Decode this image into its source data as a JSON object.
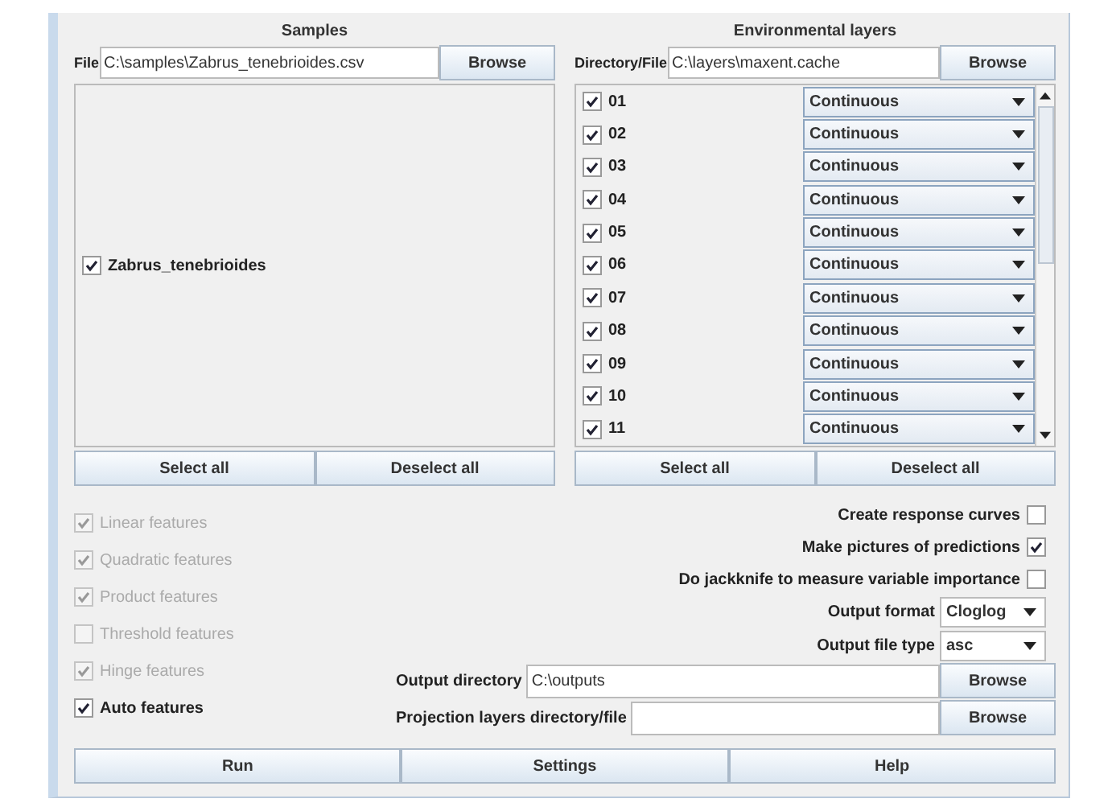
{
  "samples": {
    "title": "Samples",
    "file_label": "File",
    "file_value": "C:\\samples\\Zabrus_tenebrioides.csv",
    "browse": "Browse",
    "species": [
      {
        "name": "Zabrus_tenebrioides",
        "checked": true
      }
    ],
    "buttons": [
      "Select all",
      "Deselect all"
    ]
  },
  "layers": {
    "title": "Environmental layers",
    "dir_label": "Directory/File",
    "dir_value": "C:\\layers\\maxent.cache",
    "browse": "Browse",
    "items": [
      {
        "name": "01",
        "checked": true,
        "type": "Continuous"
      },
      {
        "name": "02",
        "checked": true,
        "type": "Continuous"
      },
      {
        "name": "03",
        "checked": true,
        "type": "Continuous"
      },
      {
        "name": "04",
        "checked": true,
        "type": "Continuous"
      },
      {
        "name": "05",
        "checked": true,
        "type": "Continuous"
      },
      {
        "name": "06",
        "checked": true,
        "type": "Continuous"
      },
      {
        "name": "07",
        "checked": true,
        "type": "Continuous"
      },
      {
        "name": "08",
        "checked": true,
        "type": "Continuous"
      },
      {
        "name": "09",
        "checked": true,
        "type": "Continuous"
      },
      {
        "name": "10",
        "checked": true,
        "type": "Continuous"
      },
      {
        "name": "11",
        "checked": true,
        "type": "Continuous"
      }
    ],
    "buttons": [
      "Select all",
      "Deselect all"
    ]
  },
  "features": [
    {
      "label": "Linear features",
      "checked": true,
      "disabled": true
    },
    {
      "label": "Quadratic features",
      "checked": true,
      "disabled": true
    },
    {
      "label": "Product features",
      "checked": true,
      "disabled": true
    },
    {
      "label": "Threshold features",
      "checked": false,
      "disabled": true
    },
    {
      "label": "Hinge features",
      "checked": true,
      "disabled": true
    },
    {
      "label": "Auto features",
      "checked": true,
      "disabled": false
    }
  ],
  "options": [
    {
      "label": "Create response curves",
      "checked": false
    },
    {
      "label": "Make pictures of predictions",
      "checked": true
    },
    {
      "label": "Do jackknife to measure variable importance",
      "checked": false
    }
  ],
  "selects": [
    {
      "label": "Output format",
      "value": "Cloglog"
    },
    {
      "label": "Output file type",
      "value": "asc"
    }
  ],
  "paths": [
    {
      "label": "Output directory",
      "value": "C:\\outputs",
      "browse": "Browse"
    },
    {
      "label": "Projection layers directory/file",
      "browse": "Browse"
    }
  ],
  "actions": [
    "Run",
    "Settings",
    "Help"
  ]
}
